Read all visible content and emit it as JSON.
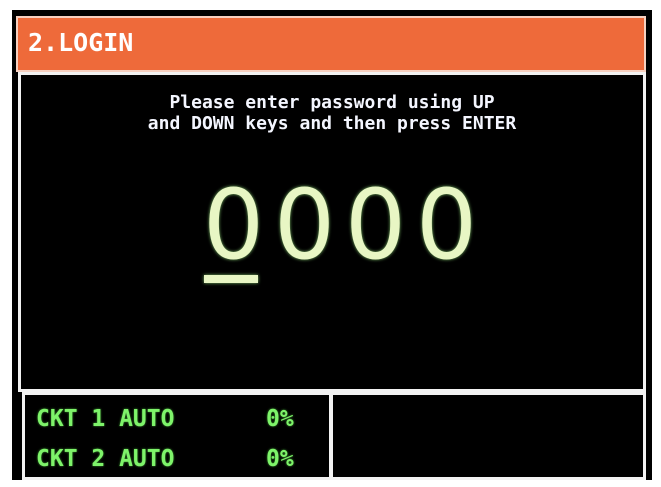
{
  "header": {
    "title": "2.LOGIN"
  },
  "login": {
    "instruction_line1": "Please enter password using UP",
    "instruction_line2": "and DOWN keys and then press ENTER",
    "password_digits": [
      "0",
      "0",
      "0",
      "0"
    ],
    "active_digit_index": 0
  },
  "status": {
    "circuits": [
      {
        "label": "CKT 1 AUTO",
        "value": "0%"
      },
      {
        "label": "CKT 2 AUTO",
        "value": "0%"
      }
    ]
  },
  "colors": {
    "title_bar": "#ee6a3a",
    "screen_background": "#000000",
    "password_text": "#e8f6c4",
    "status_text": "#7ef36a",
    "instruction_text": "#f4f6ff"
  }
}
